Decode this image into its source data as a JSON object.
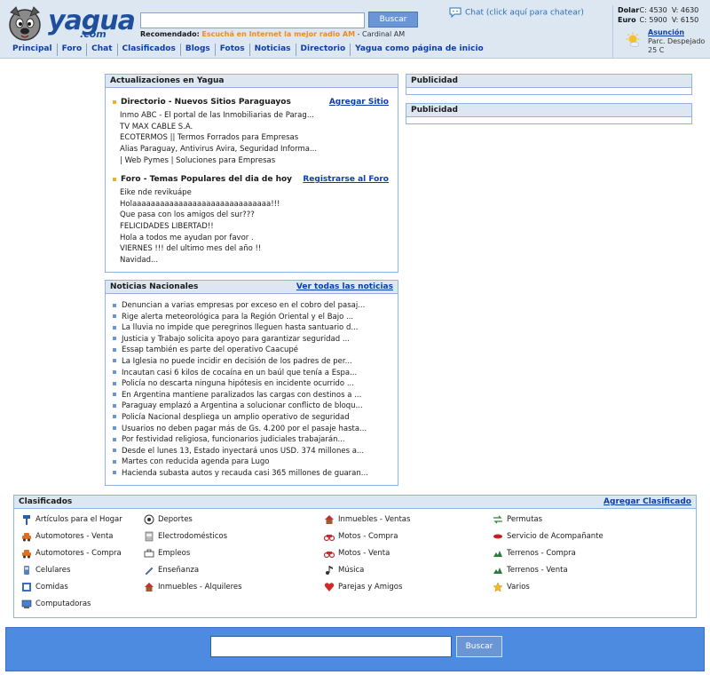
{
  "colors": {
    "header_bg": "#dde7f2",
    "link": "#0b3ea8",
    "accent_orange": "#f08a1a",
    "footer_bg": "#4c8bdf",
    "panel_border": "#94b3dc"
  },
  "header": {
    "logo_text": "yagua",
    "logo_suffix": ".com",
    "search_value": "",
    "search_button": "Buscar",
    "recomendado_label": "Recomendado:",
    "recomendado_radio": "Escuchá en Internet la mejor radio AM",
    "recomendado_rest": " - Cardinal AM",
    "chat_link": "Chat (click aquí para chatear)",
    "rates": [
      {
        "label": "Dolar",
        "compra": "C: 4530",
        "venta": "V: 4630"
      },
      {
        "label": "Euro",
        "compra": "C: 5900",
        "venta": "V: 6150"
      }
    ],
    "weather": {
      "city": "Asunción",
      "desc": "Parc. Despejado",
      "temp": "25 C"
    }
  },
  "nav": [
    "Principal",
    "Foro",
    "Chat",
    "Clasificados",
    "Blogs",
    "Fotos",
    "Noticias",
    "Directorio",
    "Yagua como página de inicio"
  ],
  "updates": {
    "title": "Actualizaciones en Yagua",
    "directorio": {
      "title": "Directorio - Nuevos Sitios Paraguayos",
      "link": "Agregar Sitio",
      "items": [
        "Inmo ABC - El portal de las Inmobiliarias de Parag...",
        "TV MAX CABLE S.A.",
        "ECOTERMOS || Termos Forrados para Empresas",
        "Alias Paraguay, Antivirus Avira, Seguridad Informa...",
        "| Web Pymes | Soluciones para Empresas"
      ]
    },
    "foro": {
      "title": "Foro - Temas Populares del dia de hoy",
      "link": "Registrarse al Foro",
      "items": [
        "Eike nde revikuápe",
        "Holaaaaaaaaaaaaaaaaaaaaaaaaaaaaaa!!!",
        "Que pasa con los amigos del sur???",
        "FELICIDADES LIBERTAD!!",
        "Hola a todos me ayudan por favor .",
        "VIERNES !!! del ultimo mes del año !!",
        "Navidad..."
      ]
    }
  },
  "news": {
    "title": "Noticias Nacionales",
    "link": "Ver todas las noticias",
    "items": [
      "Denuncian a varias empresas por exceso en el cobro del pasaj...",
      "Rige alerta meteorológica para la Región Oriental y el Bajo ...",
      "La lluvia no impide que peregrinos lleguen hasta santuario d...",
      "Justicia y Trabajo solicita apoyo para garantizar seguridad ...",
      "Essap también es parte del operativo Caacupé",
      "La Iglesia no puede incidir en decisión de los padres de per...",
      "Incautan casi 6 kilos de cocaína en un baúl que tenía a Espa...",
      "Policía no descarta ninguna hipótesis en incidente ocurrido ...",
      "En Argentina mantiene paralizados las cargas con destinos a ...",
      "Paraguay emplazó a Argentina a solucionar conflicto de bloqu...",
      "Policía Nacional despliega un amplio operativo de seguridad",
      "Usuarios no deben pagar más de Gs. 4.200 por el pasaje hasta...",
      "Por festividad religiosa, funcionarios judiciales trabajarán...",
      "Desde el lunes 13, Estado inyectará unos USD. 374 millones a...",
      "Martes con reducida agenda para Lugo",
      "Hacienda subasta autos y recauda casi 365 millones de guaran..."
    ]
  },
  "publicidad": [
    "Publicidad",
    "Publicidad"
  ],
  "clasificados": {
    "title": "Clasificados",
    "link": "Agregar Clasificado",
    "columns": [
      [
        {
          "label": "Artículos para el Hogar",
          "icon": "hammer-icon"
        },
        {
          "label": "Automotores - Venta",
          "icon": "car-icon"
        },
        {
          "label": "Automotores - Compra",
          "icon": "car-icon"
        },
        {
          "label": "Celulares",
          "icon": "phone-icon"
        },
        {
          "label": "Comidas",
          "icon": "food-icon"
        },
        {
          "label": "Computadoras",
          "icon": "computer-icon"
        }
      ],
      [
        {
          "label": "Deportes",
          "icon": "ball-icon"
        },
        {
          "label": "Electrodomésticos",
          "icon": "appliance-icon"
        },
        {
          "label": "Empleos",
          "icon": "briefcase-icon"
        },
        {
          "label": "Enseñanza",
          "icon": "pencil-icon"
        },
        {
          "label": "Inmuebles - Alquileres",
          "icon": "house-icon"
        }
      ],
      [
        {
          "label": "Inmuebles - Ventas",
          "icon": "house-icon"
        },
        {
          "label": "Motos - Compra",
          "icon": "motorcycle-icon"
        },
        {
          "label": "Motos - Venta",
          "icon": "motorcycle-icon"
        },
        {
          "label": "Música",
          "icon": "music-note-icon"
        },
        {
          "label": "Parejas y Amigos",
          "icon": "heart-icon"
        }
      ],
      [
        {
          "label": "Permutas",
          "icon": "exchange-icon"
        },
        {
          "label": "Servicio de Acompañante",
          "icon": "lips-icon"
        },
        {
          "label": "Terrenos - Compra",
          "icon": "land-icon"
        },
        {
          "label": "Terrenos - Venta",
          "icon": "land-icon"
        },
        {
          "label": "Varios",
          "icon": "star-icon"
        }
      ]
    ]
  },
  "footer": {
    "search_value": "",
    "search_button": "Buscar"
  }
}
